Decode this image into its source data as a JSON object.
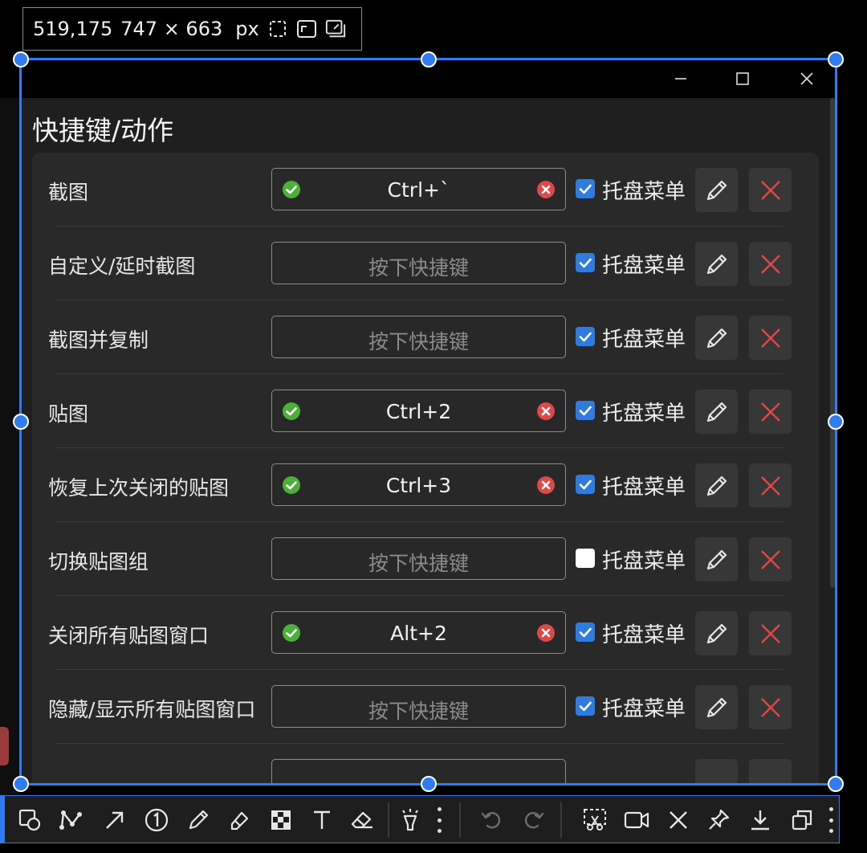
{
  "size_readout": {
    "coords": "519,175",
    "size": "747 × 663",
    "unit": "px"
  },
  "window": {
    "controls": [
      "minimize-icon",
      "maximize-icon",
      "close-icon"
    ],
    "section_title": "快捷键/动作"
  },
  "shortcuts": [
    {
      "label": "截图",
      "key": "Ctrl+`",
      "assigned": true,
      "tray_label": "托盘菜单",
      "tray_checked": true
    },
    {
      "label": "自定义/延时截图",
      "key": "按下快捷键",
      "assigned": false,
      "tray_label": "托盘菜单",
      "tray_checked": true
    },
    {
      "label": "截图并复制",
      "key": "按下快捷键",
      "assigned": false,
      "tray_label": "托盘菜单",
      "tray_checked": true
    },
    {
      "label": "贴图",
      "key": "Ctrl+2",
      "assigned": true,
      "tray_label": "托盘菜单",
      "tray_checked": true
    },
    {
      "label": "恢复上次关闭的贴图",
      "key": "Ctrl+3",
      "assigned": true,
      "tray_label": "托盘菜单",
      "tray_checked": true
    },
    {
      "label": "切换贴图组",
      "key": "按下快捷键",
      "assigned": false,
      "tray_label": "托盘菜单",
      "tray_checked": false
    },
    {
      "label": "关闭所有贴图窗口",
      "key": "Alt+2",
      "assigned": true,
      "tray_label": "托盘菜单",
      "tray_checked": true
    },
    {
      "label": "隐藏/显示所有贴图窗口",
      "key": "按下快捷键",
      "assigned": false,
      "tray_label": "托盘菜单",
      "tray_checked": true
    }
  ],
  "colors": {
    "accent": "#2e7cf0",
    "success": "#4caf3a",
    "danger": "#e04848",
    "checkbox": "#2f7bde"
  },
  "toolbar": {
    "tools": [
      "rectangle-icon",
      "polyline-icon",
      "arrow-icon",
      "number-marker-icon",
      "pencil-icon",
      "highlighter-icon",
      "mosaic-icon",
      "text-icon",
      "eraser-icon",
      "spotlight-icon",
      "more-icon",
      "undo-icon",
      "redo-icon",
      "crop-cut-icon",
      "record-video-icon",
      "cancel-icon",
      "pin-icon",
      "save-download-icon",
      "copy-icon",
      "more-icon"
    ]
  }
}
